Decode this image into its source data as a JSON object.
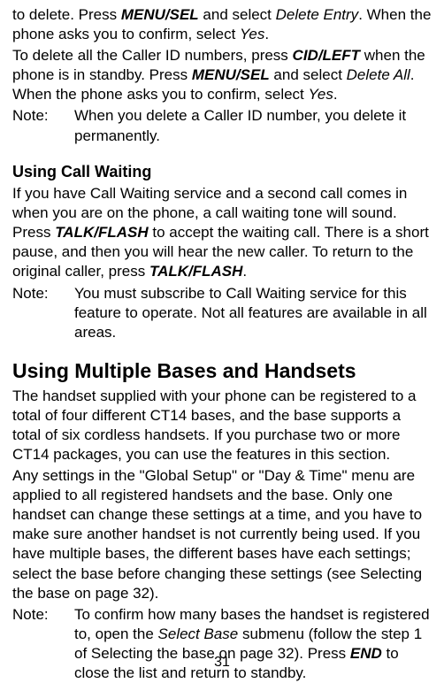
{
  "p1_a": "to delete. Press ",
  "p1_b": "MENU/SEL",
  "p1_c": " and select ",
  "p1_d": "Delete Entry",
  "p1_e": ". When the phone asks you to confirm, select ",
  "p1_f": "Yes",
  "p1_g": ".",
  "p2_a": "To delete all the Caller ID numbers, press ",
  "p2_b": "CID/LEFT",
  "p2_c": " when the phone is in standby. Press ",
  "p2_d": "MENU/SEL",
  "p2_e": " and select ",
  "p2_f": "Delete All",
  "p2_g": ". When the phone asks you to confirm, select ",
  "p2_h": "Yes",
  "p2_i": ".",
  "note1_label": "Note:",
  "note1_text": "When you delete a Caller ID number, you delete it permanently.",
  "h1": "Using Call Waiting",
  "p3_a": "If you have Call Waiting service and a second call comes in when you are on the phone, a call waiting tone will sound. Press ",
  "p3_b": "TALK/FLASH",
  "p3_c": " to accept the waiting call. There is a short pause, and then you will hear the new caller. To return to the original caller, press ",
  "p3_d": "TALK/FLASH",
  "p3_e": ".",
  "note2_label": "Note:",
  "note2_text": "You must subscribe to Call Waiting service for this feature to operate. Not all features are available in all areas.",
  "h2": "Using Multiple Bases and Handsets",
  "p4": "The handset supplied with your phone can be registered to a total of four different CT14 bases, and the base supports a total of six cordless handsets. If you purchase two or more CT14 packages, you can use the features in this section.",
  "p5": "Any settings in the \"Global Setup\" or \"Day & Time\" menu are applied to all registered handsets and the base. Only one handset can change these settings at a time, and you have to make sure another handset is not currently being used. If you have multiple bases, the different bases have each settings; select the base before changing these settings (see Selecting the base on page 32).",
  "note3_label": "Note:",
  "note3_a": "To confirm how many bases the handset is registered to, open the ",
  "note3_b": "Select Base",
  "note3_c": " submenu (follow the step 1 of Selecting the base on page 32). Press ",
  "note3_d": "END",
  "note3_e": " to close the list and return to standby.",
  "page_number": "31"
}
